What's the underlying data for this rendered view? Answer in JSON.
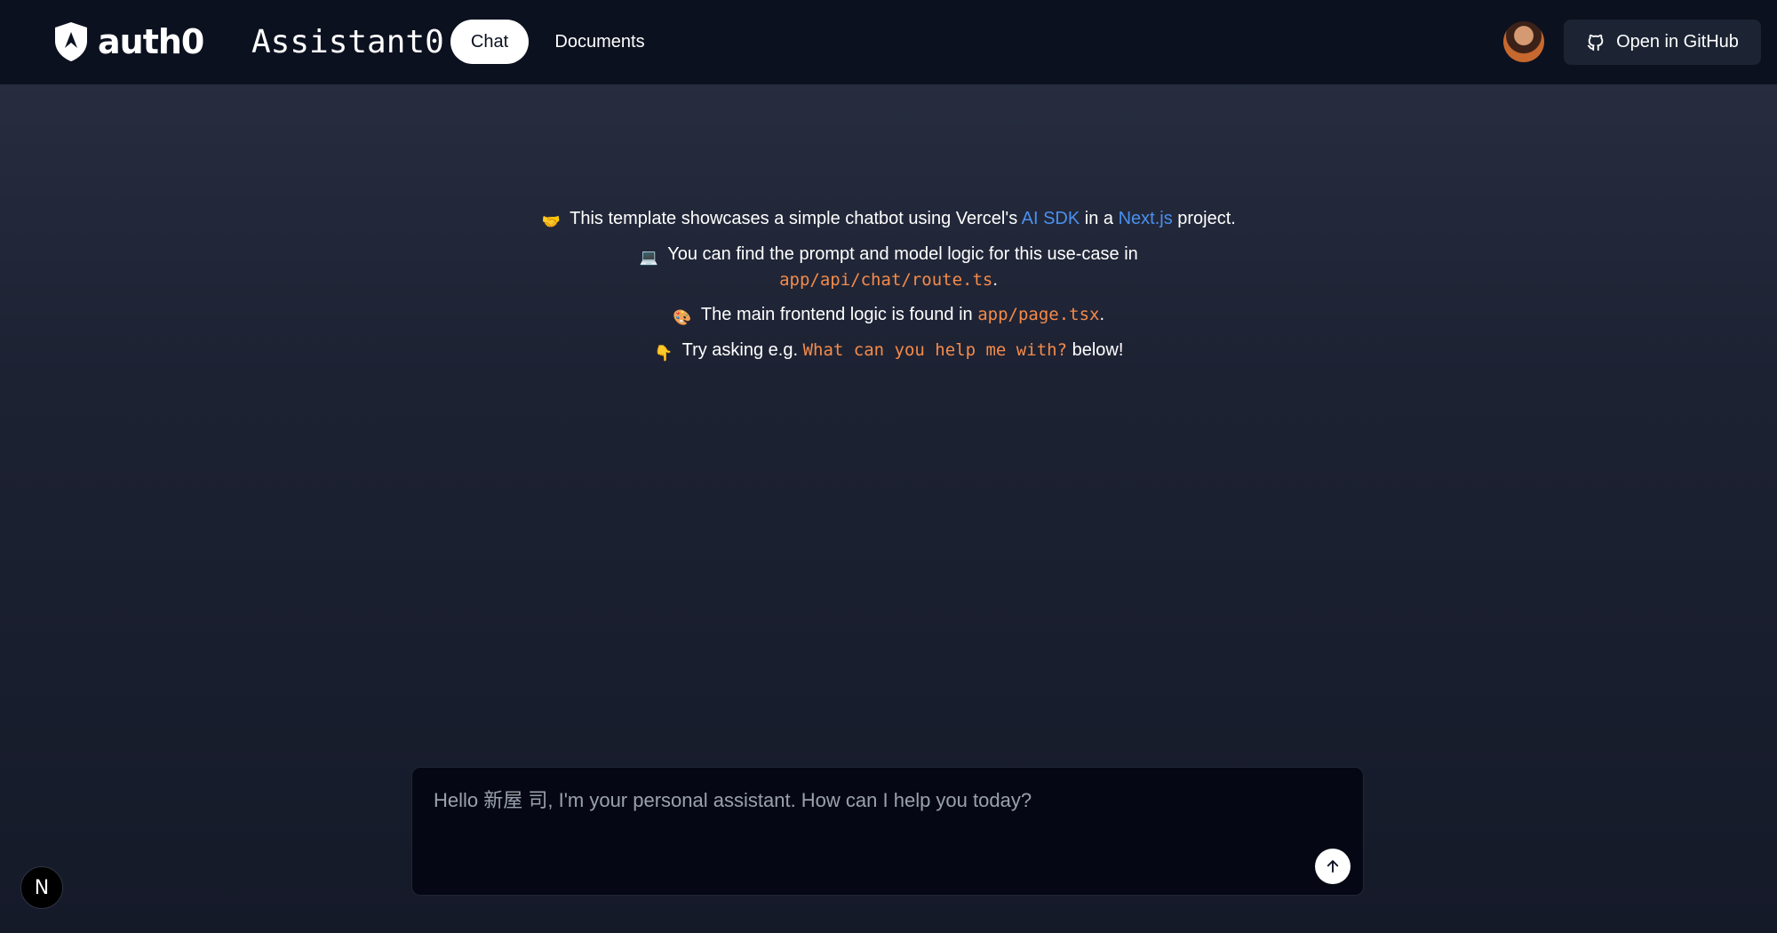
{
  "header": {
    "logo_text": "auth0",
    "app_title": "Assistant0",
    "nav": {
      "chat_label": "Chat",
      "documents_label": "Documents"
    },
    "github_label": "Open in GitHub"
  },
  "intro": {
    "line1": {
      "emoji": "🤝",
      "text_before": "This template showcases a simple chatbot using Vercel's ",
      "link1": "AI SDK",
      "text_mid": " in a ",
      "link2": "Next.js",
      "text_after": " project."
    },
    "line2": {
      "emoji": "💻",
      "text_before": "You can find the prompt and model logic for this use-case in ",
      "code": "app/api/chat/route.ts",
      "text_after": "."
    },
    "line3": {
      "emoji": "🎨",
      "text_before": "The main frontend logic is found in ",
      "code": "app/page.tsx",
      "text_after": "."
    },
    "line4": {
      "emoji": "👇",
      "text_before": "Try asking e.g. ",
      "code": "What can you help me with?",
      "text_after": " below!"
    }
  },
  "composer": {
    "placeholder": "Hello 新屋 司, I'm your personal assistant. How can I help you today?",
    "value": ""
  },
  "dev_badge": {
    "label": "N"
  },
  "colors": {
    "header_bg": "#0c1120",
    "link": "#4a90f0",
    "code": "#f58b4a",
    "composer_bg": "#050814"
  }
}
